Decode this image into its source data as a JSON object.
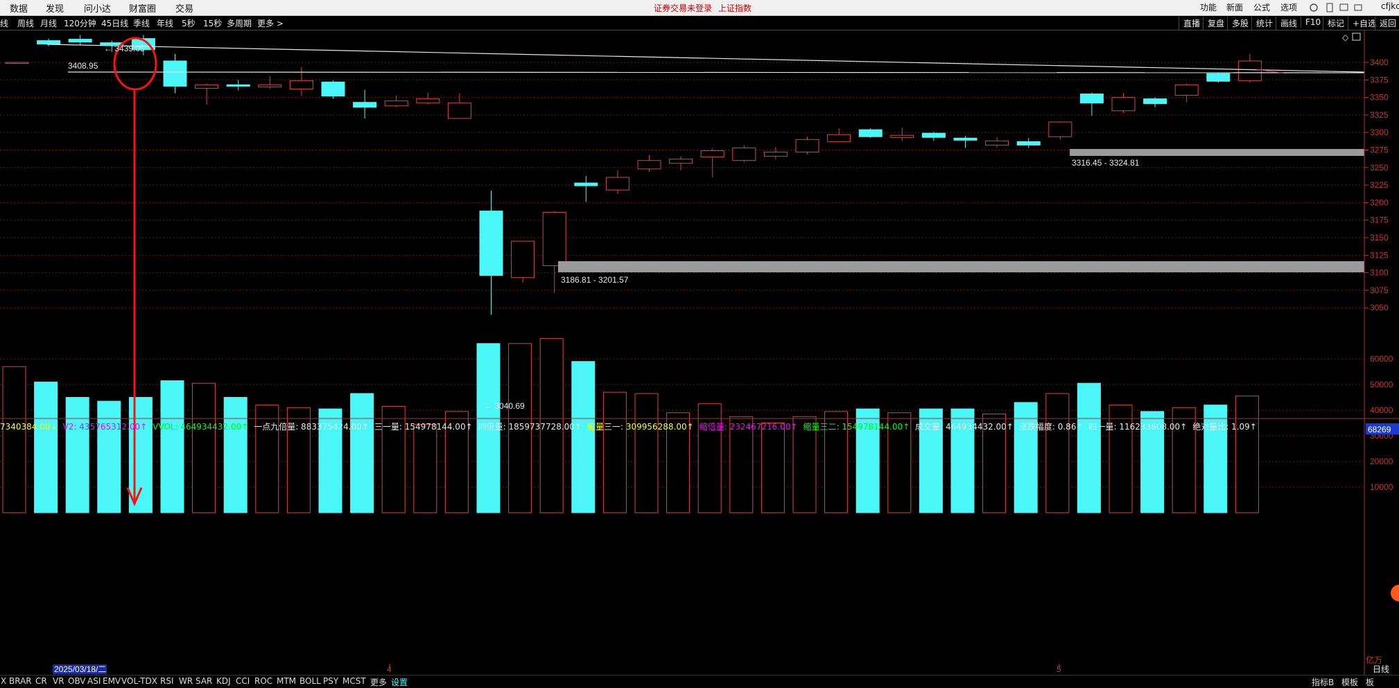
{
  "menu": [
    "数据",
    "发现",
    "问小达",
    "财富圈",
    "交易"
  ],
  "notice": {
    "login": "证券交易未登录",
    "index": "上证指数"
  },
  "top_right": [
    "功能",
    "新面",
    "公式",
    "选项"
  ],
  "user": "cfjkcz",
  "period_tabs": [
    "线",
    "周线",
    "月线",
    "120分钟",
    "45日线",
    "季线",
    "年线",
    "5秒",
    "15秒",
    "多周期",
    "更多 >"
  ],
  "toolbar": [
    "直播",
    "复盘",
    "多股",
    "统计",
    "画线",
    "F10",
    "标记",
    "+自选",
    "返回"
  ],
  "price_labels": {
    "high": "3439.05",
    "left_line": "3408.95",
    "low": "3040.69",
    "gap1": "3186.81 - 3201.57",
    "gap2": "3316.45 - 3324.81"
  },
  "price_axis": [
    "3400",
    "3375",
    "3350",
    "3325",
    "3300",
    "3275",
    "3250",
    "3225",
    "3200",
    "3175",
    "3150",
    "3125",
    "3100",
    "3075",
    "3050"
  ],
  "volume_axis": [
    "60000",
    "50000",
    "40000",
    "30000",
    "20000",
    "10000"
  ],
  "volume_axis_top": "68269",
  "volume_unit": "亿万",
  "date_labels": {
    "d1": "2025/03/18/二",
    "m4": "4",
    "m5": "5"
  },
  "indicators": [
    {
      "text": "7340384.00↓",
      "color": "#ffff00"
    },
    {
      "text": "V2: 435765312.00↑",
      "color": "#ff00ff"
    },
    {
      "text": "VVOL: 464934432.00↑",
      "color": "#00ff00"
    },
    {
      "text": "一点九倍量: 883375424.00↑",
      "color": "#e8e8e8"
    },
    {
      "text": "三一量: 154978144.00↑",
      "color": "#e8e8e8"
    },
    {
      "text": "四倍量: 1859737728.00↑",
      "color": "#e8e8e8"
    },
    {
      "text": "缩量三一: 309956288.00↑",
      "color": "#ffff00"
    },
    {
      "text": "缩倍量: 232467216.00↑",
      "color": "#ff00ff"
    },
    {
      "text": "缩量三二: 154978144.00↑",
      "color": "#00ff00"
    },
    {
      "text": "成交量: 464934432.00↑",
      "color": "#e8e8e8"
    },
    {
      "text": "涨跌幅度: 0.86↑",
      "color": "#e8e8e8"
    },
    {
      "text": "四一量: 116233608.00↑",
      "color": "#e8e8e8"
    },
    {
      "text": "绝对量比: 1.09↑",
      "color": "#e8e8e8"
    }
  ],
  "bottom_tabs": [
    "X",
    "BRAR",
    "CR",
    "VR",
    "OBV",
    "ASI",
    "EMV",
    "VOL-TDX",
    "RSI",
    "WR",
    "SAR",
    "KDJ",
    "CCI",
    "ROC",
    "MTM",
    "BOLL",
    "PSY",
    "MCST",
    "更多",
    "设置"
  ],
  "bottom_right": [
    "指标B",
    "模板",
    "板"
  ],
  "period_right": "日线",
  "candles": [
    {
      "o": 3400,
      "c": 3400,
      "h": 3400,
      "l": 3400
    },
    {
      "o": 3431,
      "c": 3426,
      "h": 3434,
      "l": 3423
    },
    {
      "o": 3433,
      "c": 3429,
      "h": 3439,
      "l": 3425
    },
    {
      "o": 3428,
      "c": 3425,
      "h": 3431,
      "l": 3415
    },
    {
      "o": 3434,
      "c": 3418,
      "h": 3439,
      "l": 3410
    },
    {
      "o": 3402,
      "c": 3366,
      "h": 3412,
      "l": 3356
    },
    {
      "o": 3363,
      "c": 3368,
      "h": 3370,
      "l": 3340
    },
    {
      "o": 3368,
      "c": 3366,
      "h": 3375,
      "l": 3360
    },
    {
      "o": 3365,
      "c": 3368,
      "h": 3380,
      "l": 3362
    },
    {
      "o": 3362,
      "c": 3374,
      "h": 3393,
      "l": 3352
    },
    {
      "o": 3372,
      "c": 3352,
      "h": 3374,
      "l": 3348
    },
    {
      "o": 3343,
      "c": 3336,
      "h": 3361,
      "l": 3320
    },
    {
      "o": 3338,
      "c": 3345,
      "h": 3353,
      "l": 3336
    },
    {
      "o": 3342,
      "c": 3348,
      "h": 3357,
      "l": 3340
    },
    {
      "o": 3320,
      "c": 3342,
      "h": 3356,
      "l": 3320
    },
    {
      "o": 3188,
      "c": 3096,
      "h": 3217,
      "l": 3040
    },
    {
      "o": 3093,
      "c": 3145,
      "h": 3145,
      "l": 3086
    },
    {
      "o": 3110,
      "c": 3186,
      "h": 3188,
      "l": 3071
    },
    {
      "o": 3228,
      "c": 3224,
      "h": 3238,
      "l": 3201
    },
    {
      "o": 3218,
      "c": 3236,
      "h": 3246,
      "l": 3212
    },
    {
      "o": 3248,
      "c": 3260,
      "h": 3268,
      "l": 3244
    },
    {
      "o": 3256,
      "c": 3262,
      "h": 3266,
      "l": 3246
    },
    {
      "o": 3265,
      "c": 3274,
      "h": 3277,
      "l": 3236
    },
    {
      "o": 3260,
      "c": 3278,
      "h": 3282,
      "l": 3258
    },
    {
      "o": 3266,
      "c": 3272,
      "h": 3279,
      "l": 3262
    },
    {
      "o": 3272,
      "c": 3290,
      "h": 3294,
      "l": 3269
    },
    {
      "o": 3287,
      "c": 3297,
      "h": 3306,
      "l": 3286
    },
    {
      "o": 3304,
      "c": 3294,
      "h": 3306,
      "l": 3292
    },
    {
      "o": 3293,
      "c": 3296,
      "h": 3307,
      "l": 3288
    },
    {
      "o": 3299,
      "c": 3293,
      "h": 3301,
      "l": 3288
    },
    {
      "o": 3292,
      "c": 3289,
      "h": 3295,
      "l": 3278
    },
    {
      "o": 3282,
      "c": 3288,
      "h": 3293,
      "l": 3279
    },
    {
      "o": 3287,
      "c": 3282,
      "h": 3292,
      "l": 3278
    },
    {
      "o": 3294,
      "c": 3315,
      "h": 3316,
      "l": 3290
    },
    {
      "o": 3355,
      "c": 3342,
      "h": 3357,
      "l": 3324
    },
    {
      "o": 3331,
      "c": 3350,
      "h": 3356,
      "l": 3328
    },
    {
      "o": 3348,
      "c": 3341,
      "h": 3350,
      "l": 3336
    },
    {
      "o": 3353,
      "c": 3368,
      "h": 3370,
      "l": 3343
    },
    {
      "o": 3384,
      "c": 3373,
      "h": 3385,
      "l": 3371
    },
    {
      "o": 3374,
      "c": 3402,
      "h": 3412,
      "l": 3371
    }
  ],
  "volumes": [
    57000,
    51000,
    45000,
    43500,
    45000,
    51500,
    50500,
    45000,
    42000,
    41000,
    40500,
    46500,
    41500,
    34500,
    39500,
    66000,
    66000,
    68000,
    59000,
    47000,
    46500,
    39000,
    42500,
    37500,
    35000,
    37500,
    39500,
    40500,
    39000,
    40500,
    40500,
    38500,
    43000,
    46500,
    50500,
    42000,
    39500,
    41000,
    42000,
    45500
  ]
}
